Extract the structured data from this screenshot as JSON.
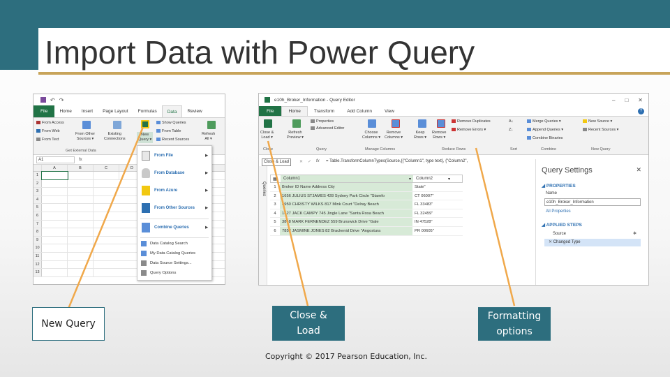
{
  "slide": {
    "title": "Import Data with Power Query",
    "copyright": "Copyright © 2017 Pearson Education, Inc.",
    "accent_color": "#2d6e7e",
    "underline_color": "#c8a45a"
  },
  "callouts": {
    "new_query": "New Query",
    "close_load_1": "Close &",
    "close_load_2": "Load",
    "formatting_1": "Formatting",
    "formatting_2": "options"
  },
  "excel": {
    "tabs": [
      "File",
      "Home",
      "Insert",
      "Page Layout",
      "Formulas",
      "Data",
      "Review"
    ],
    "ribbon": {
      "from_access": "From Access",
      "from_web": "From Web",
      "from_text": "From Text",
      "from_other_1": "From Other",
      "from_other_2": "Sources ▾",
      "existing_1": "Existing",
      "existing_2": "Connections",
      "new_query_1": "New",
      "new_query_2": "Query ▾",
      "show_queries": "Show Queries",
      "from_table": "From Table",
      "recent_sources": "Recent Sources",
      "refresh_1": "Refresh",
      "refresh_2": "All ▾",
      "group_label": "Get External Data"
    },
    "name_box": "A1",
    "columns": [
      "A",
      "B",
      "C",
      "D"
    ],
    "rows": [
      "1",
      "2",
      "3",
      "4",
      "5",
      "6",
      "7",
      "8",
      "9",
      "10",
      "11",
      "12",
      "13"
    ],
    "menu": {
      "from_file": "From File",
      "from_database": "From Database",
      "from_azure": "From Azure",
      "from_other_sources": "From Other Sources",
      "combine_queries": "Combine Queries",
      "data_catalog_search": "Data Catalog Search",
      "my_data_catalog": "My Data Catalog Queries",
      "data_source_settings": "Data Source Settings...",
      "query_options": "Query Options"
    }
  },
  "query_editor": {
    "window_title": "e10h_Broker_Information - Query Editor",
    "tabs": [
      "File",
      "Home",
      "Transform",
      "Add Column",
      "View"
    ],
    "ribbon": {
      "close_load_1": "Close &",
      "close_load_2": "Load ▾",
      "refresh_1": "Refresh",
      "refresh_2": "Preview ▾",
      "properties": "Properties",
      "advanced_editor": "Advanced Editor",
      "choose_1": "Choose",
      "choose_2": "Columns ▾",
      "remove_1": "Remove",
      "remove_2": "Columns ▾",
      "keep_1": "Keep",
      "keep_2": "Rows ▾",
      "remove_rows_1": "Remove",
      "remove_rows_2": "Rows ▾",
      "remove_duplicates": "Remove Duplicates",
      "remove_errors": "Remove Errors ▾",
      "merge_queries": "Merge Queries ▾",
      "append_queries": "Append Queries ▾",
      "combine_binaries": "Combine Binaries",
      "new_source": "New Source ▾",
      "recent_sources": "Recent Sources ▾",
      "grp_close": "Close",
      "grp_query": "Query",
      "grp_manage": "Manage Columns",
      "grp_reduce": "Reduce Rows",
      "grp_sort": "Sort",
      "grp_combine": "Combine",
      "grp_new_query": "New Query"
    },
    "tooltip": "Close & Load",
    "formula": "= Table.TransformColumnTypes(Source,{{\"Column1\", type text}, {\"Column2\",",
    "nav_label": "Queries",
    "table": {
      "headers": [
        "Column1",
        "Column2"
      ],
      "rows": [
        {
          "n": "1",
          "c1": "Broker ID   Name   Address  City",
          "c2": "State\""
        },
        {
          "n": "2",
          "c1": "1656  JULIUS STJAMES  428 Sydney Park Circle  \"Stamfo",
          "c2": "CT 06007\""
        },
        {
          "n": "3",
          "c1": "4950  CHRISTY WILKS  817 Mink Court  \"Delray Beach",
          "c2": "FL 33483\""
        },
        {
          "n": "4",
          "c1": "1627  JACK CAMPY  745 Jingle Lane  \"Santa Rosa Beach",
          "c2": "FL 32459\""
        },
        {
          "n": "5",
          "c1": "3848  MARK FERNENDEZ  559 Brunswick Drive  \"Gale",
          "c2": "IN 47528\""
        },
        {
          "n": "6",
          "c1": "7852  JASMINE JONES  82 Brackenid Drive  \"Angostura",
          "c2": "PR 00605\""
        }
      ]
    },
    "settings": {
      "title": "Query Settings",
      "properties": "PROPERTIES",
      "name_label": "Name",
      "name_value": "e10h_Broker_Information",
      "all_properties": "All Properties",
      "applied_steps": "APPLIED STEPS",
      "steps": [
        "Source",
        "Changed Type"
      ]
    }
  }
}
